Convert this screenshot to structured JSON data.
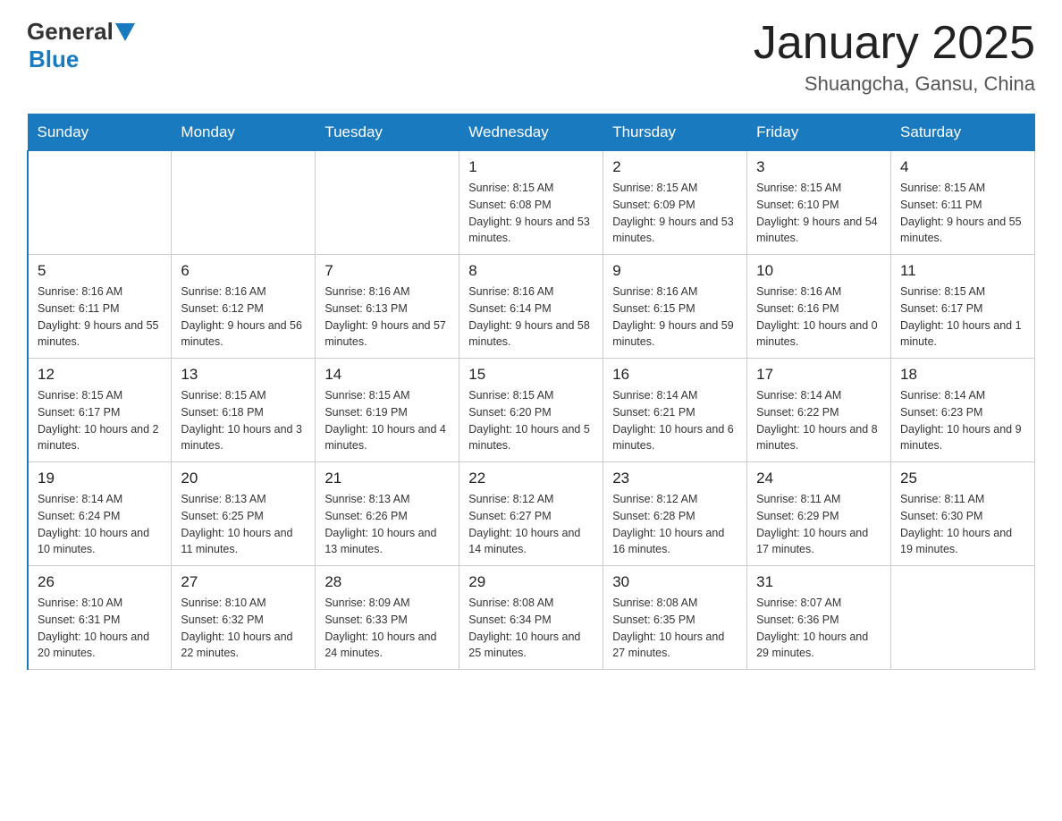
{
  "header": {
    "logo_general": "General",
    "logo_blue": "Blue",
    "title": "January 2025",
    "subtitle": "Shuangcha, Gansu, China"
  },
  "days_of_week": [
    "Sunday",
    "Monday",
    "Tuesday",
    "Wednesday",
    "Thursday",
    "Friday",
    "Saturday"
  ],
  "weeks": [
    [
      {
        "day": "",
        "info": ""
      },
      {
        "day": "",
        "info": ""
      },
      {
        "day": "",
        "info": ""
      },
      {
        "day": "1",
        "info": "Sunrise: 8:15 AM\nSunset: 6:08 PM\nDaylight: 9 hours\nand 53 minutes."
      },
      {
        "day": "2",
        "info": "Sunrise: 8:15 AM\nSunset: 6:09 PM\nDaylight: 9 hours\nand 53 minutes."
      },
      {
        "day": "3",
        "info": "Sunrise: 8:15 AM\nSunset: 6:10 PM\nDaylight: 9 hours\nand 54 minutes."
      },
      {
        "day": "4",
        "info": "Sunrise: 8:15 AM\nSunset: 6:11 PM\nDaylight: 9 hours\nand 55 minutes."
      }
    ],
    [
      {
        "day": "5",
        "info": "Sunrise: 8:16 AM\nSunset: 6:11 PM\nDaylight: 9 hours\nand 55 minutes."
      },
      {
        "day": "6",
        "info": "Sunrise: 8:16 AM\nSunset: 6:12 PM\nDaylight: 9 hours\nand 56 minutes."
      },
      {
        "day": "7",
        "info": "Sunrise: 8:16 AM\nSunset: 6:13 PM\nDaylight: 9 hours\nand 57 minutes."
      },
      {
        "day": "8",
        "info": "Sunrise: 8:16 AM\nSunset: 6:14 PM\nDaylight: 9 hours\nand 58 minutes."
      },
      {
        "day": "9",
        "info": "Sunrise: 8:16 AM\nSunset: 6:15 PM\nDaylight: 9 hours\nand 59 minutes."
      },
      {
        "day": "10",
        "info": "Sunrise: 8:16 AM\nSunset: 6:16 PM\nDaylight: 10 hours\nand 0 minutes."
      },
      {
        "day": "11",
        "info": "Sunrise: 8:15 AM\nSunset: 6:17 PM\nDaylight: 10 hours\nand 1 minute."
      }
    ],
    [
      {
        "day": "12",
        "info": "Sunrise: 8:15 AM\nSunset: 6:17 PM\nDaylight: 10 hours\nand 2 minutes."
      },
      {
        "day": "13",
        "info": "Sunrise: 8:15 AM\nSunset: 6:18 PM\nDaylight: 10 hours\nand 3 minutes."
      },
      {
        "day": "14",
        "info": "Sunrise: 8:15 AM\nSunset: 6:19 PM\nDaylight: 10 hours\nand 4 minutes."
      },
      {
        "day": "15",
        "info": "Sunrise: 8:15 AM\nSunset: 6:20 PM\nDaylight: 10 hours\nand 5 minutes."
      },
      {
        "day": "16",
        "info": "Sunrise: 8:14 AM\nSunset: 6:21 PM\nDaylight: 10 hours\nand 6 minutes."
      },
      {
        "day": "17",
        "info": "Sunrise: 8:14 AM\nSunset: 6:22 PM\nDaylight: 10 hours\nand 8 minutes."
      },
      {
        "day": "18",
        "info": "Sunrise: 8:14 AM\nSunset: 6:23 PM\nDaylight: 10 hours\nand 9 minutes."
      }
    ],
    [
      {
        "day": "19",
        "info": "Sunrise: 8:14 AM\nSunset: 6:24 PM\nDaylight: 10 hours\nand 10 minutes."
      },
      {
        "day": "20",
        "info": "Sunrise: 8:13 AM\nSunset: 6:25 PM\nDaylight: 10 hours\nand 11 minutes."
      },
      {
        "day": "21",
        "info": "Sunrise: 8:13 AM\nSunset: 6:26 PM\nDaylight: 10 hours\nand 13 minutes."
      },
      {
        "day": "22",
        "info": "Sunrise: 8:12 AM\nSunset: 6:27 PM\nDaylight: 10 hours\nand 14 minutes."
      },
      {
        "day": "23",
        "info": "Sunrise: 8:12 AM\nSunset: 6:28 PM\nDaylight: 10 hours\nand 16 minutes."
      },
      {
        "day": "24",
        "info": "Sunrise: 8:11 AM\nSunset: 6:29 PM\nDaylight: 10 hours\nand 17 minutes."
      },
      {
        "day": "25",
        "info": "Sunrise: 8:11 AM\nSunset: 6:30 PM\nDaylight: 10 hours\nand 19 minutes."
      }
    ],
    [
      {
        "day": "26",
        "info": "Sunrise: 8:10 AM\nSunset: 6:31 PM\nDaylight: 10 hours\nand 20 minutes."
      },
      {
        "day": "27",
        "info": "Sunrise: 8:10 AM\nSunset: 6:32 PM\nDaylight: 10 hours\nand 22 minutes."
      },
      {
        "day": "28",
        "info": "Sunrise: 8:09 AM\nSunset: 6:33 PM\nDaylight: 10 hours\nand 24 minutes."
      },
      {
        "day": "29",
        "info": "Sunrise: 8:08 AM\nSunset: 6:34 PM\nDaylight: 10 hours\nand 25 minutes."
      },
      {
        "day": "30",
        "info": "Sunrise: 8:08 AM\nSunset: 6:35 PM\nDaylight: 10 hours\nand 27 minutes."
      },
      {
        "day": "31",
        "info": "Sunrise: 8:07 AM\nSunset: 6:36 PM\nDaylight: 10 hours\nand 29 minutes."
      },
      {
        "day": "",
        "info": ""
      }
    ]
  ]
}
